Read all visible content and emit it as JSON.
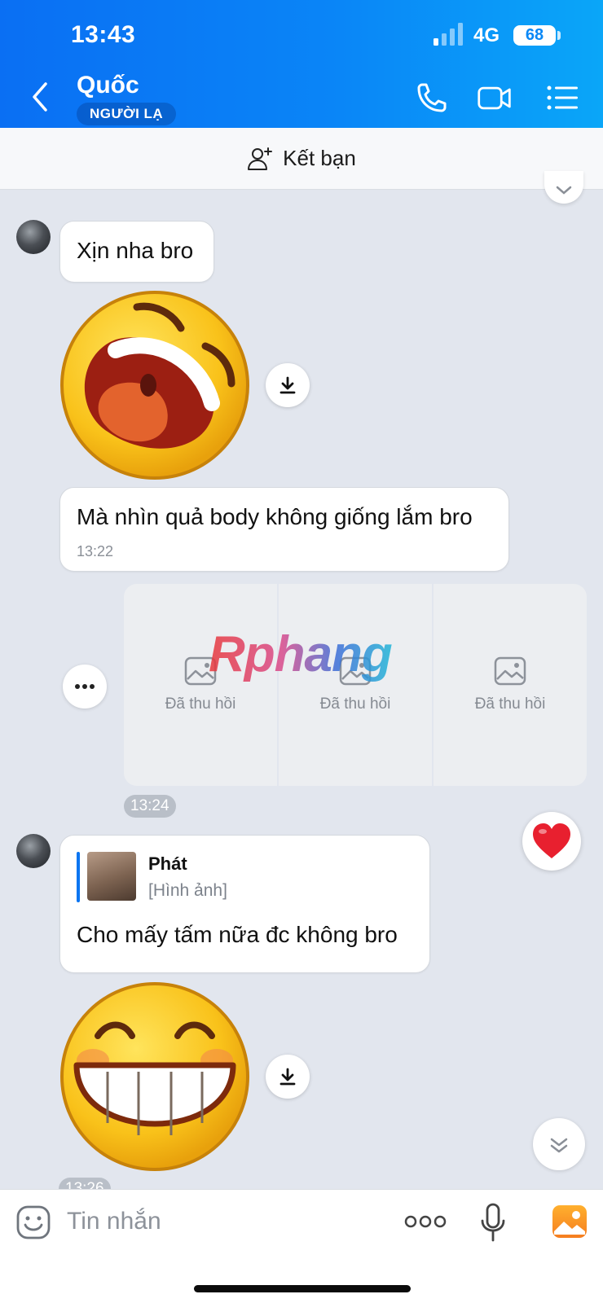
{
  "status": {
    "time": "13:43",
    "network": "4G",
    "battery": "68"
  },
  "header": {
    "name": "Quốc",
    "badge": "NGƯỜI LẠ"
  },
  "friend_bar": {
    "label": "Kết bạn"
  },
  "messages": {
    "m1": {
      "text": "Xịn nha bro"
    },
    "m2": {
      "text": "Mà nhìn quả body không giống lắm bro",
      "time": "13:22"
    },
    "recalled": {
      "label": "Đã thu hồi",
      "time": "13:24"
    },
    "m3": {
      "quote_sender": "Phát",
      "quote_text": "[Hình ảnh]",
      "text": "Cho mấy tấm nữa đc không bro",
      "partial_time": "13:26"
    }
  },
  "watermark": {
    "text": "Rphang"
  },
  "input": {
    "placeholder": "Tin nhắn"
  },
  "colors": {
    "header_start": "#0a6ff3",
    "header_end": "#0aa6f8",
    "chat_bg": "#e2e6ee",
    "heart": "#e8202f"
  },
  "icons": [
    "back-icon",
    "phone-icon",
    "video-icon",
    "menu-icon",
    "add-friend-icon",
    "download-icon",
    "image-placeholder-icon",
    "more-icon",
    "heart-icon",
    "chevron-down-icon",
    "emoji-icon",
    "mic-icon",
    "gallery-icon"
  ]
}
